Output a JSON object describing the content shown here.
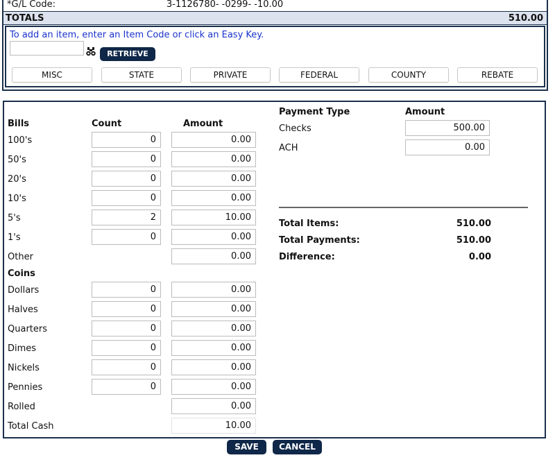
{
  "gl": {
    "label": "*G/L Code:",
    "value": "3-1126780- -0299- -10.00"
  },
  "totals": {
    "label": "TOTALS",
    "value": "510.00"
  },
  "add_item": {
    "instruction": "To add an item, enter an Item Code or click an Easy Key.",
    "item_code_value": "",
    "search_icon": "binoculars-icon",
    "retrieve_label": "RETRIEVE",
    "easy_keys": [
      "MISC",
      "STATE",
      "PRIVATE",
      "FEDERAL",
      "COUNTY",
      "REBATE"
    ]
  },
  "cash": {
    "bills_header": "Bills",
    "count_header": "Count",
    "amount_header": "Amount",
    "bills": [
      {
        "label": "100's",
        "count": "0",
        "amount": "0.00"
      },
      {
        "label": "50's",
        "count": "0",
        "amount": "0.00"
      },
      {
        "label": "20's",
        "count": "0",
        "amount": "0.00"
      },
      {
        "label": "10's",
        "count": "0",
        "amount": "0.00"
      },
      {
        "label": "5's",
        "count": "2",
        "amount": "10.00"
      },
      {
        "label": "1's",
        "count": "0",
        "amount": "0.00"
      }
    ],
    "other": {
      "label": "Other",
      "amount": "0.00"
    },
    "coins_header": "Coins",
    "coins": [
      {
        "label": "Dollars",
        "count": "0",
        "amount": "0.00"
      },
      {
        "label": "Halves",
        "count": "0",
        "amount": "0.00"
      },
      {
        "label": "Quarters",
        "count": "0",
        "amount": "0.00"
      },
      {
        "label": "Dimes",
        "count": "0",
        "amount": "0.00"
      },
      {
        "label": "Nickels",
        "count": "0",
        "amount": "0.00"
      },
      {
        "label": "Pennies",
        "count": "0",
        "amount": "0.00"
      }
    ],
    "rolled": {
      "label": "Rolled",
      "amount": "0.00"
    },
    "total_cash": {
      "label": "Total Cash",
      "amount": "10.00"
    }
  },
  "payments": {
    "type_header": "Payment Type",
    "amount_header": "Amount",
    "rows": [
      {
        "label": "Checks",
        "amount": "500.00"
      },
      {
        "label": "ACH",
        "amount": "0.00"
      }
    ]
  },
  "summary": {
    "total_items_label": "Total Items:",
    "total_items_value": "510.00",
    "total_payments_label": "Total Payments:",
    "total_payments_value": "510.00",
    "difference_label": "Difference:",
    "difference_value": "0.00"
  },
  "actions": {
    "save_label": "SAVE",
    "cancel_label": "CANCEL"
  }
}
